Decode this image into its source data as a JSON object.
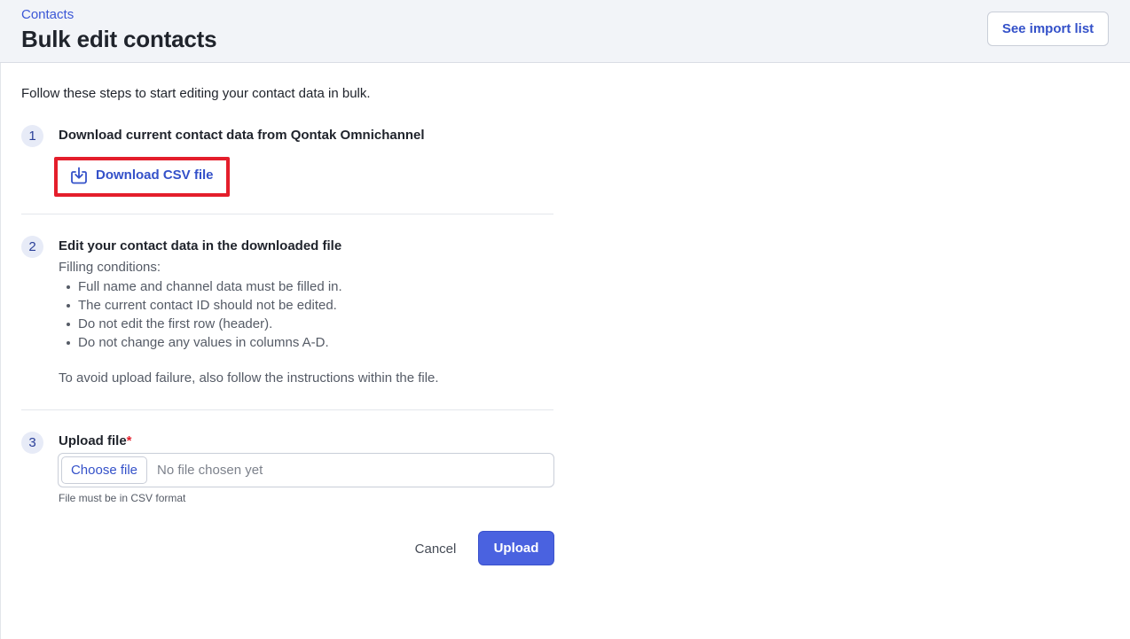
{
  "header": {
    "breadcrumb": "Contacts",
    "title": "Bulk edit contacts",
    "see_import_list_label": "See import list"
  },
  "intro": "Follow these steps to start editing your contact data in bulk.",
  "steps": [
    {
      "number": "1",
      "title": "Download current contact data from Qontak Omnichannel",
      "download_button_label": "Download CSV file",
      "download_icon": "download-tray-icon"
    },
    {
      "number": "2",
      "title": "Edit your contact data in the downloaded file",
      "conditions_heading": "Filling conditions:",
      "conditions": [
        "Full name and channel data must be filled in.",
        "The current contact ID should not be edited.",
        "Do not edit the first row (header).",
        "Do not change any values in columns A-D."
      ],
      "note": "To avoid upload failure, also follow the instructions within the file."
    },
    {
      "number": "3",
      "title": "Upload file",
      "required_mark": "*",
      "choose_file_label": "Choose file",
      "no_file_text": "No file chosen yet",
      "hint": "File must be in CSV format"
    }
  ],
  "actions": {
    "cancel_label": "Cancel",
    "upload_label": "Upload"
  },
  "colors": {
    "accent": "#3451c9",
    "primary_button": "#4a62e0",
    "highlight": "#e41e2b"
  }
}
